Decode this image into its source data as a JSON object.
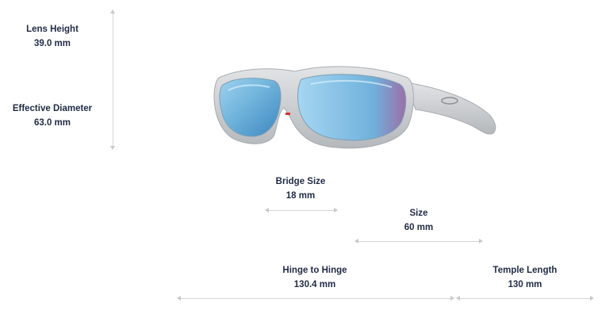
{
  "measurements": {
    "lens_height": {
      "label": "Lens Height",
      "value": "39.0 mm"
    },
    "effective_diameter": {
      "label": "Effective Diameter",
      "value": "63.0 mm"
    },
    "bridge_size": {
      "label": "Bridge Size",
      "value": "18 mm"
    },
    "size": {
      "label": "Size",
      "value": "60 mm"
    },
    "hinge_to_hinge": {
      "label": "Hinge to Hinge",
      "value": "130.4 mm"
    },
    "temple_length": {
      "label": "Temple Length",
      "value": "130 mm"
    }
  },
  "colors": {
    "text": "#1f2a44",
    "frame": "#c9cccf",
    "lens": "#7ab8dd",
    "measure_line": "#d4d4d4"
  },
  "icons": {
    "product": "sunglasses-icon"
  }
}
